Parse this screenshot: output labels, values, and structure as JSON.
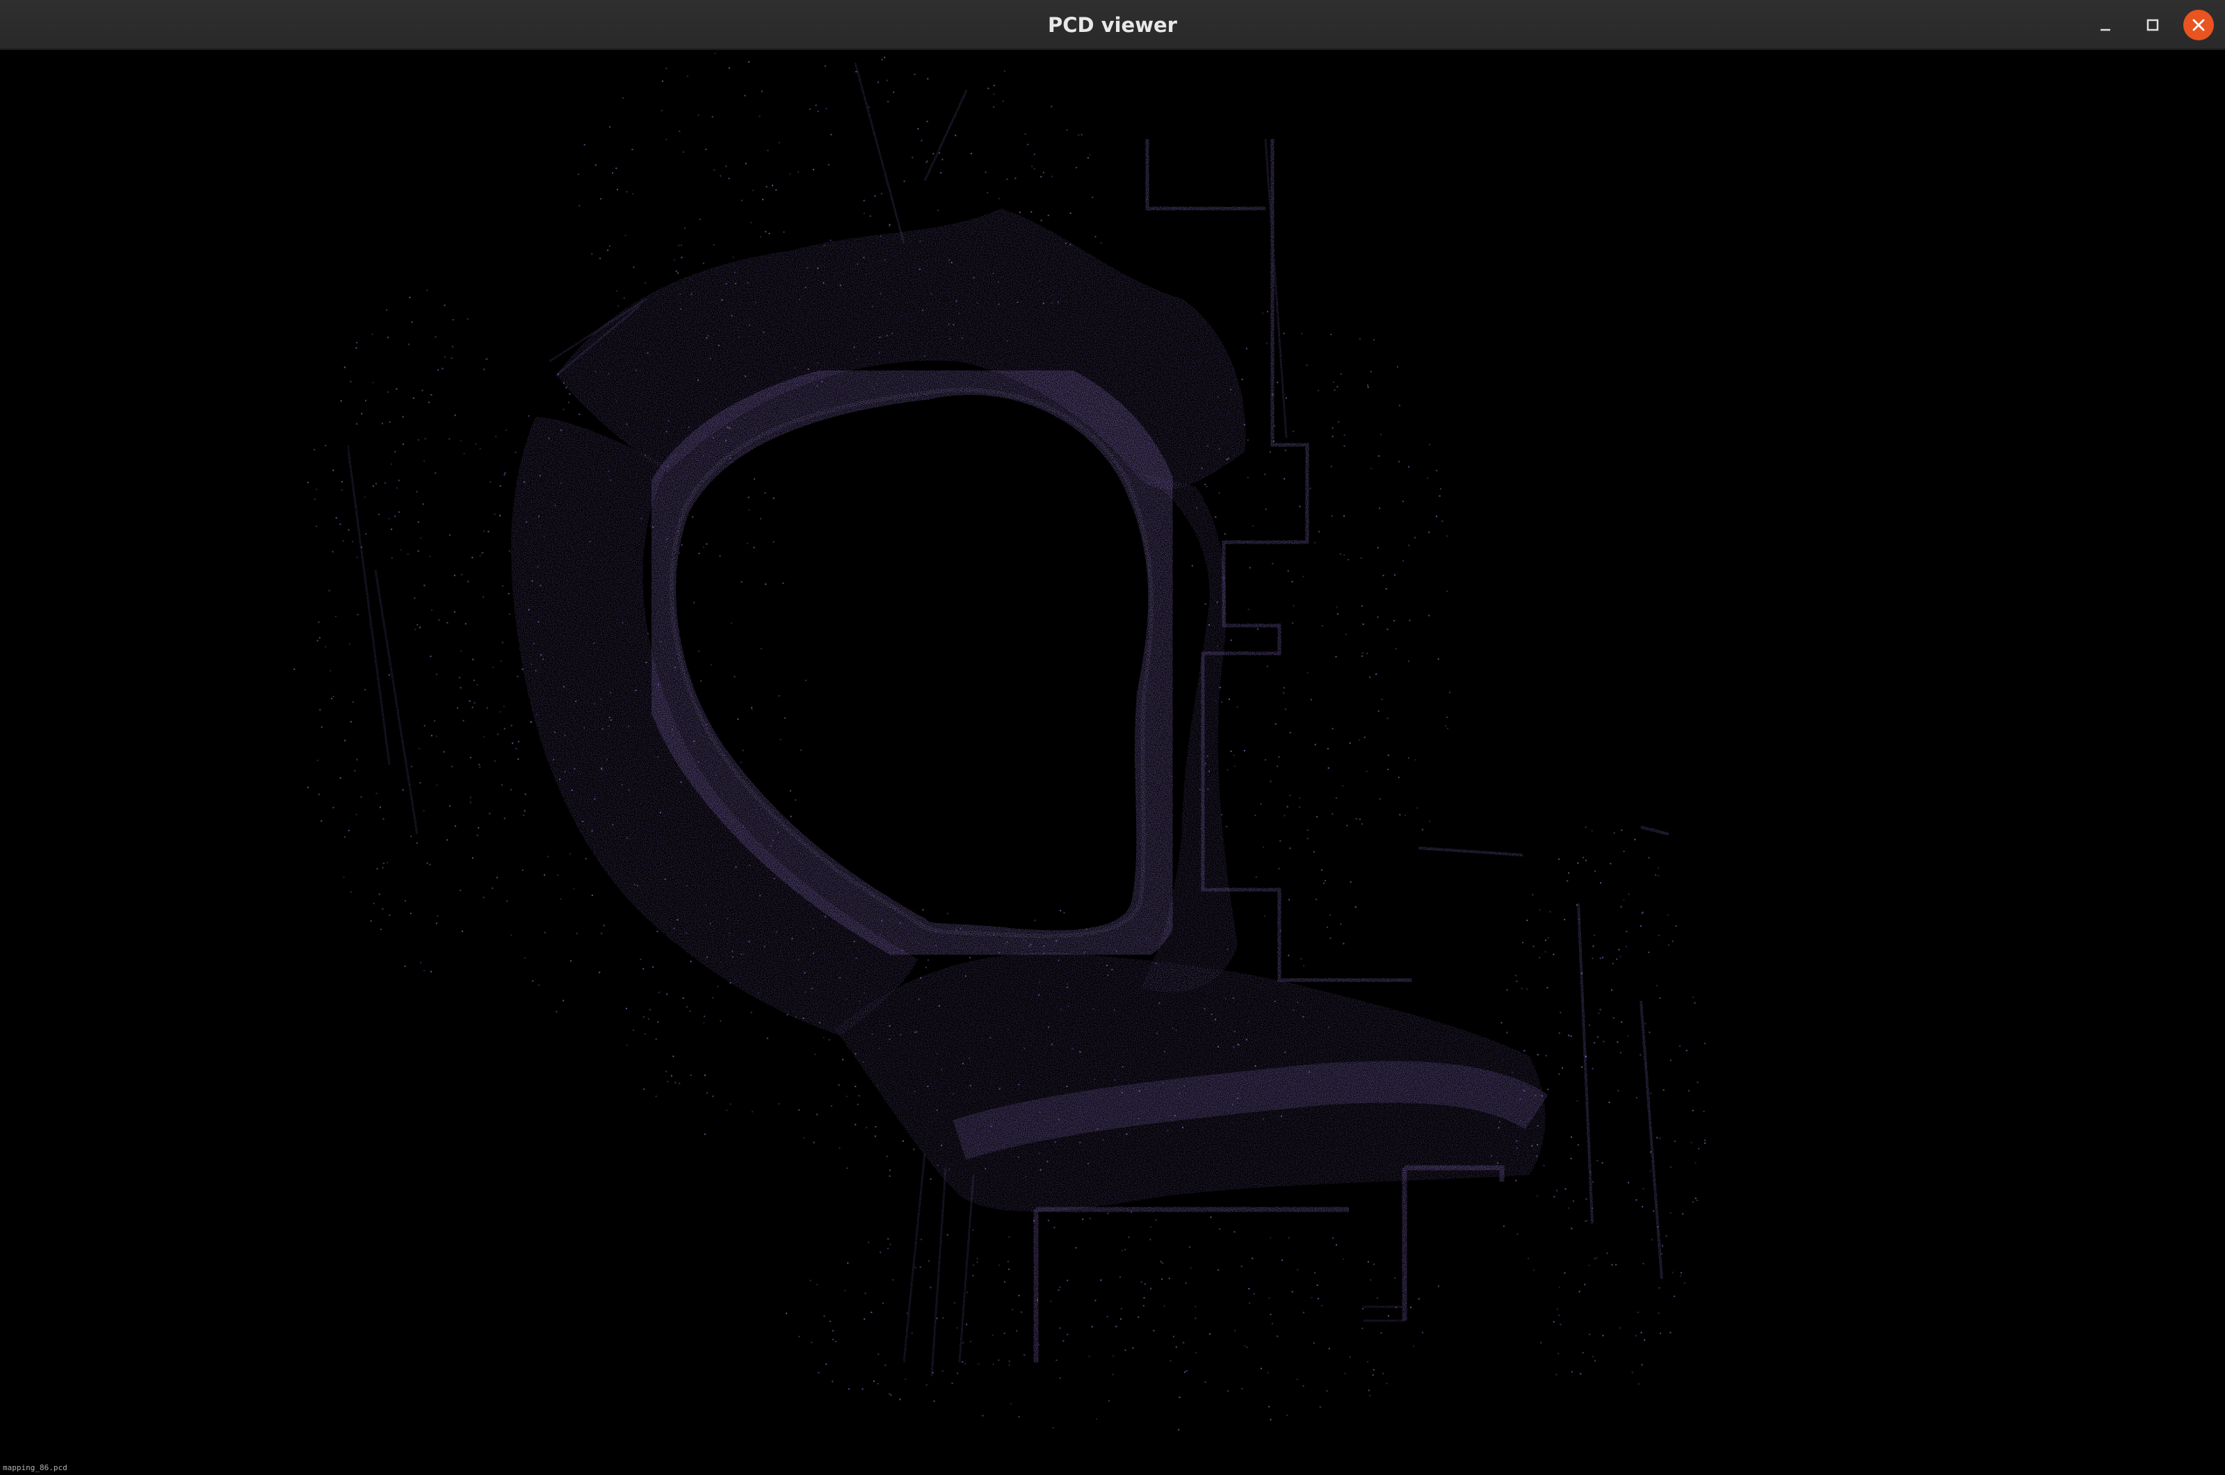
{
  "window": {
    "title": "PCD viewer",
    "controls": {
      "minimize": "minimize-icon",
      "maximize": "maximize-icon",
      "close": "close-icon"
    }
  },
  "viewer": {
    "background_color": "#000000",
    "point_color": "#8a70c8",
    "status_text": "mapping_86.pcd"
  },
  "colors": {
    "titlebar": "#2c2c2c",
    "close_button": "#e95420",
    "title_text": "#e8e8e8"
  }
}
